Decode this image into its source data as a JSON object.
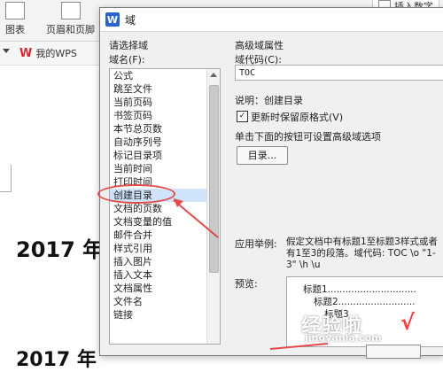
{
  "background": {
    "ribbon": {
      "chart_label": "图表",
      "header_footer_label": "页眉和页脚",
      "insert_number_label": "插入数字"
    },
    "tabs": {
      "wps_logo": "W",
      "my_wps_label": "我的WPS"
    },
    "document": {
      "heading_1": "2017 年",
      "heading_2": "2017 年"
    }
  },
  "dialog": {
    "title": "域",
    "title_icon": "W",
    "select_field_label": "请选择域",
    "field_name_label": "域名(F):",
    "field_list": [
      "公式",
      "跳至文件",
      "当前页码",
      "书签页码",
      "本节总页数",
      "自动序列号",
      "标记目录项",
      "当前时间",
      "打印时间",
      "创建目录",
      "文档的页数",
      "文档变量的值",
      "邮件合并",
      "样式引用",
      "插入图片",
      "插入文本",
      "文档属性",
      "文件名",
      "链接"
    ],
    "selected_index": 9,
    "advanced_label": "高级域属性",
    "field_code_label": "域代码(C):",
    "field_code_value": "TOC",
    "description": "说明：创建目录",
    "preserve_format_label": "更新时保留原格式(V)",
    "preserve_format_checked": true,
    "instruction": "单击下面的按钮可设置高级域选项",
    "toc_button_label": "目录...",
    "example_label": "应用举例:",
    "example_text": "假定文档中有标题1至标题3样式或者有1至3的段落。域代码: TOC \\o \"1-3\" \\h \\u",
    "preview_label": "预览:",
    "preview_lines": [
      "标题1..............................",
      "标题2..........................",
      "标题3"
    ]
  },
  "watermark": {
    "main": "经验啦",
    "check": "√",
    "url": "jingyanla.com"
  }
}
